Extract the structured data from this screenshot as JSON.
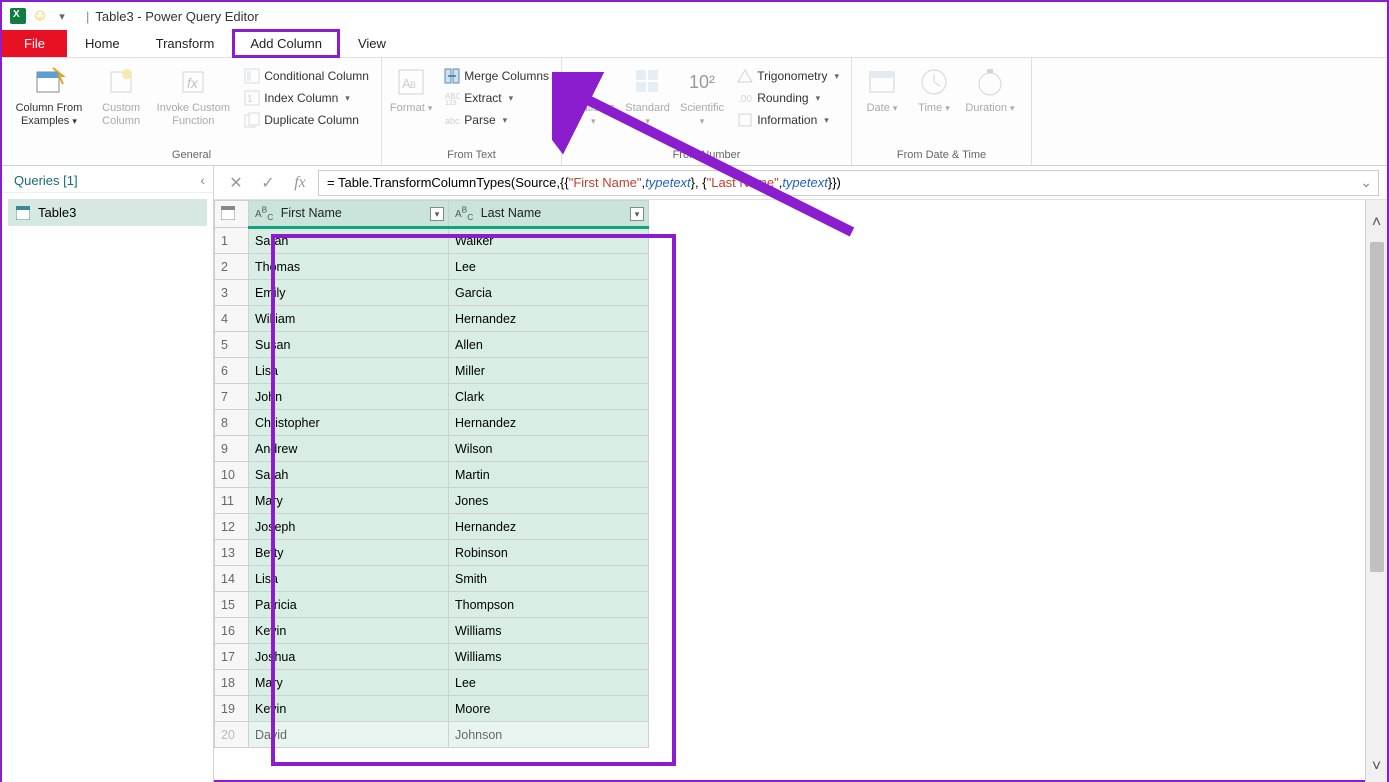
{
  "title": "Table3 - Power Query Editor",
  "tabs": {
    "file": "File",
    "home": "Home",
    "transform": "Transform",
    "addcolumn": "Add Column",
    "view": "View"
  },
  "ribbon": {
    "general": {
      "col_from_examples": "Column From\nExamples",
      "custom_column": "Custom\nColumn",
      "invoke_custom": "Invoke Custom\nFunction",
      "conditional": "Conditional Column",
      "index": "Index Column",
      "duplicate": "Duplicate Column",
      "group": "General"
    },
    "from_text": {
      "format": "Format",
      "merge": "Merge Columns",
      "extract": "Extract",
      "parse": "Parse",
      "group": "From Text"
    },
    "from_number": {
      "statistics": "Statistics",
      "standard": "Standard",
      "scientific": "Scientific",
      "trig": "Trigonometry",
      "rounding": "Rounding",
      "information": "Information",
      "sci_exp": "10²",
      "group": "From Number"
    },
    "from_datetime": {
      "date": "Date",
      "time": "Time",
      "duration": "Duration",
      "group": "From Date & Time"
    }
  },
  "queries": {
    "header": "Queries [1]",
    "item": "Table3"
  },
  "formula_prefix": "= Table.TransformColumnTypes(Source,{{",
  "formula_fn": "\"First Name\"",
  "formula_mid": ", ",
  "formula_type1": "type",
  "formula_txt1": " text",
  "formula_sep": "}, {",
  "formula_ln": "\"Last Name\"",
  "formula_end": "}})",
  "columns": {
    "first": "First Name",
    "last": "Last Name"
  },
  "rows": [
    {
      "n": "1",
      "f": "Sarah",
      "l": "Walker"
    },
    {
      "n": "2",
      "f": "Thomas",
      "l": "Lee"
    },
    {
      "n": "3",
      "f": "Emily",
      "l": "Garcia"
    },
    {
      "n": "4",
      "f": "William",
      "l": "Hernandez"
    },
    {
      "n": "5",
      "f": "Susan",
      "l": "Allen"
    },
    {
      "n": "6",
      "f": "Lisa",
      "l": "Miller"
    },
    {
      "n": "7",
      "f": "John",
      "l": "Clark"
    },
    {
      "n": "8",
      "f": "Christopher",
      "l": "Hernandez"
    },
    {
      "n": "9",
      "f": "Andrew",
      "l": "Wilson"
    },
    {
      "n": "10",
      "f": "Sarah",
      "l": "Martin"
    },
    {
      "n": "11",
      "f": "Mary",
      "l": "Jones"
    },
    {
      "n": "12",
      "f": "Joseph",
      "l": "Hernandez"
    },
    {
      "n": "13",
      "f": "Betty",
      "l": "Robinson"
    },
    {
      "n": "14",
      "f": "Lisa",
      "l": "Smith"
    },
    {
      "n": "15",
      "f": "Patricia",
      "l": "Thompson"
    },
    {
      "n": "16",
      "f": "Kevin",
      "l": "Williams"
    },
    {
      "n": "17",
      "f": "Joshua",
      "l": "Williams"
    },
    {
      "n": "18",
      "f": "Mary",
      "l": "Lee"
    },
    {
      "n": "19",
      "f": "Kevin",
      "l": "Moore"
    },
    {
      "n": "20",
      "f": "David",
      "l": "Johnson"
    }
  ]
}
